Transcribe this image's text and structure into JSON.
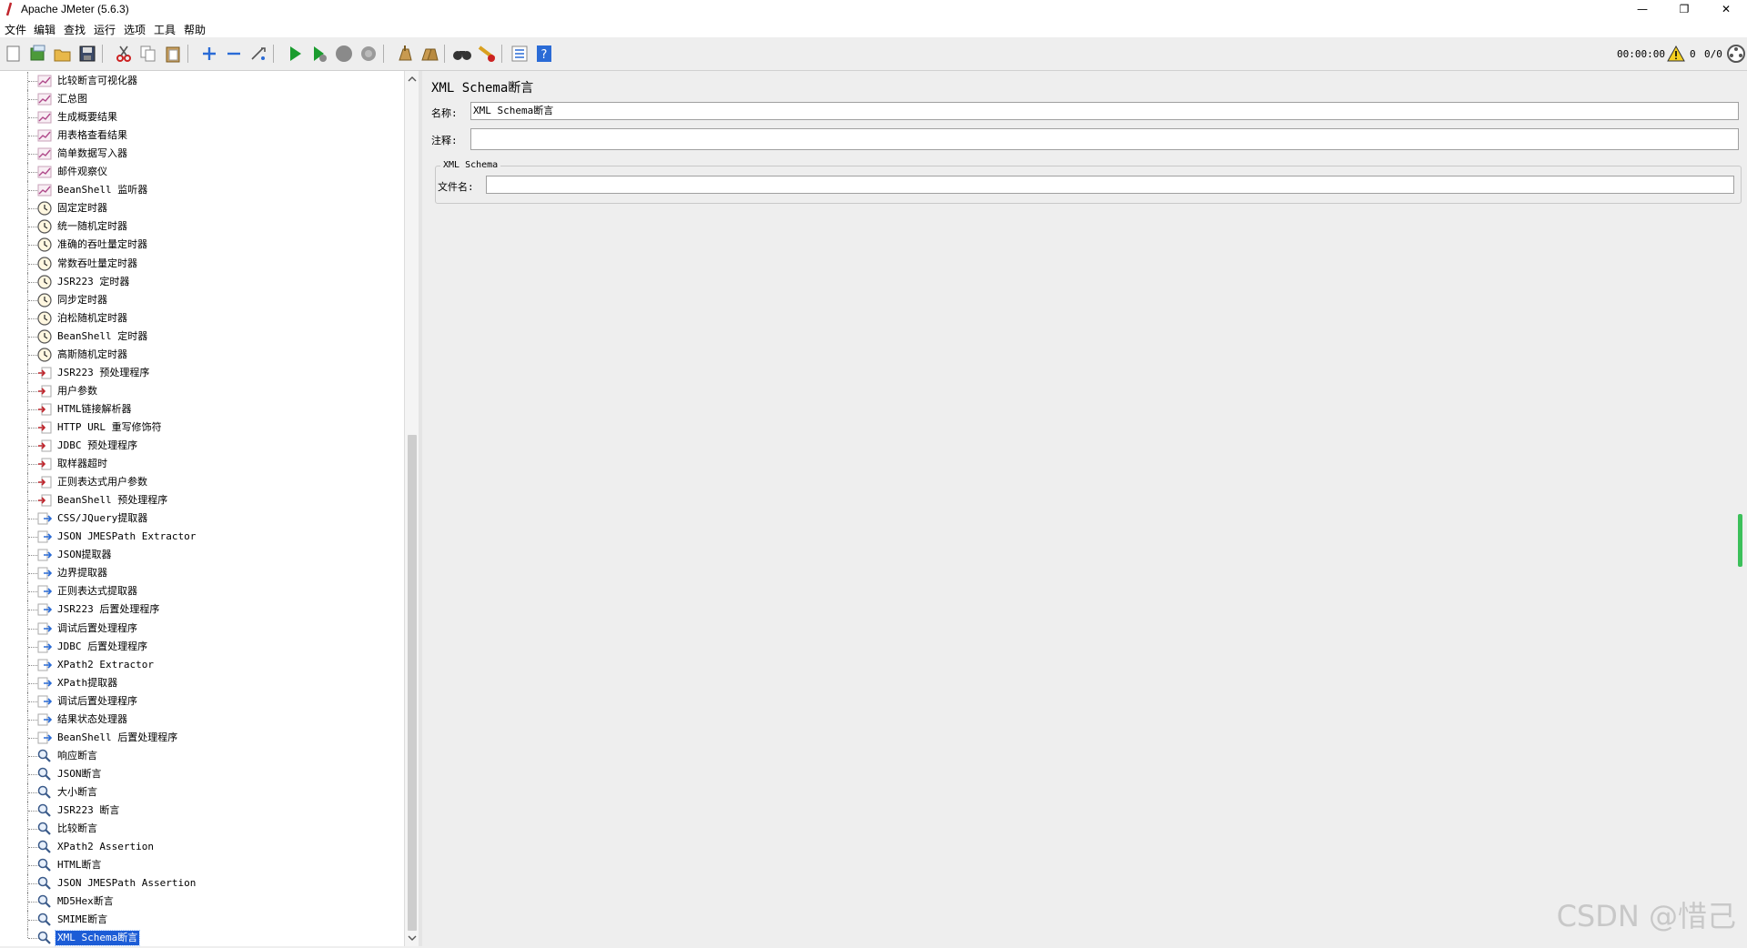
{
  "window": {
    "title": "Apache JMeter (5.6.3)",
    "minimize": "—",
    "restore": "❐",
    "close": "✕"
  },
  "menu": [
    "文件",
    "编辑",
    "查找",
    "运行",
    "选项",
    "工具",
    "帮助"
  ],
  "toolbar": {
    "buttons": [
      "new",
      "templates",
      "open",
      "save",
      "cut",
      "copy",
      "paste",
      "expand",
      "collapse",
      "toggle",
      "start",
      "start-no-pauses",
      "stop",
      "shutdown",
      "clear",
      "clear-all",
      "search",
      "reset-search",
      "function-helper",
      "help"
    ],
    "elapsed_time": "00:00:00",
    "error_count": "0",
    "thread_count": "0/0"
  },
  "tree": {
    "items": [
      {
        "label": "比较断言可视化器",
        "icon": "listener"
      },
      {
        "label": "汇总图",
        "icon": "listener"
      },
      {
        "label": "生成概要结果",
        "icon": "listener"
      },
      {
        "label": "用表格查看结果",
        "icon": "listener"
      },
      {
        "label": "简单数据写入器",
        "icon": "listener"
      },
      {
        "label": "邮件观察仪",
        "icon": "listener"
      },
      {
        "label": "BeanShell 监听器",
        "icon": "listener"
      },
      {
        "label": "固定定时器",
        "icon": "timer"
      },
      {
        "label": "统一随机定时器",
        "icon": "timer"
      },
      {
        "label": "准确的吞吐量定时器",
        "icon": "timer"
      },
      {
        "label": "常数吞吐量定时器",
        "icon": "timer"
      },
      {
        "label": "JSR223 定时器",
        "icon": "timer"
      },
      {
        "label": "同步定时器",
        "icon": "timer"
      },
      {
        "label": "泊松随机定时器",
        "icon": "timer"
      },
      {
        "label": "BeanShell 定时器",
        "icon": "timer"
      },
      {
        "label": "高斯随机定时器",
        "icon": "timer"
      },
      {
        "label": "JSR223 预处理程序",
        "icon": "preprocessor"
      },
      {
        "label": "用户参数",
        "icon": "preprocessor"
      },
      {
        "label": "HTML链接解析器",
        "icon": "preprocessor"
      },
      {
        "label": "HTTP URL 重写修饰符",
        "icon": "preprocessor"
      },
      {
        "label": "JDBC 预处理程序",
        "icon": "preprocessor"
      },
      {
        "label": "取样器超时",
        "icon": "preprocessor"
      },
      {
        "label": "正则表达式用户参数",
        "icon": "preprocessor"
      },
      {
        "label": "BeanShell 预处理程序",
        "icon": "preprocessor"
      },
      {
        "label": "CSS/JQuery提取器",
        "icon": "postprocessor"
      },
      {
        "label": "JSON JMESPath Extractor",
        "icon": "postprocessor"
      },
      {
        "label": "JSON提取器",
        "icon": "postprocessor"
      },
      {
        "label": "边界提取器",
        "icon": "postprocessor"
      },
      {
        "label": "正则表达式提取器",
        "icon": "postprocessor"
      },
      {
        "label": "JSR223 后置处理程序",
        "icon": "postprocessor"
      },
      {
        "label": "调试后置处理程序",
        "icon": "postprocessor"
      },
      {
        "label": "JDBC 后置处理程序",
        "icon": "postprocessor"
      },
      {
        "label": "XPath2 Extractor",
        "icon": "postprocessor"
      },
      {
        "label": "XPath提取器",
        "icon": "postprocessor"
      },
      {
        "label": "调试后置处理程序",
        "icon": "postprocessor"
      },
      {
        "label": "结果状态处理器",
        "icon": "postprocessor"
      },
      {
        "label": "BeanShell 后置处理程序",
        "icon": "postprocessor"
      },
      {
        "label": "响应断言",
        "icon": "assertion"
      },
      {
        "label": "JSON断言",
        "icon": "assertion"
      },
      {
        "label": "大小断言",
        "icon": "assertion"
      },
      {
        "label": "JSR223 断言",
        "icon": "assertion"
      },
      {
        "label": "比较断言",
        "icon": "assertion"
      },
      {
        "label": "XPath2 Assertion",
        "icon": "assertion"
      },
      {
        "label": "HTML断言",
        "icon": "assertion"
      },
      {
        "label": "JSON JMESPath Assertion",
        "icon": "assertion"
      },
      {
        "label": "MD5Hex断言",
        "icon": "assertion"
      },
      {
        "label": "SMIME断言",
        "icon": "assertion"
      },
      {
        "label": "XML Schema断言",
        "icon": "assertion",
        "selected": true
      }
    ]
  },
  "panel": {
    "title": "XML Schema断言",
    "name_label": "名称:",
    "name_value": "XML Schema断言",
    "comment_label": "注释:",
    "comment_value": "",
    "group_title": "XML Schema",
    "filename_label": "文件名:",
    "filename_value": ""
  },
  "watermark": "CSDN @惜己",
  "colors": {
    "selection": "#1c5cd6",
    "start_green": "#1a9c2e",
    "help_blue": "#2a6bd6"
  }
}
